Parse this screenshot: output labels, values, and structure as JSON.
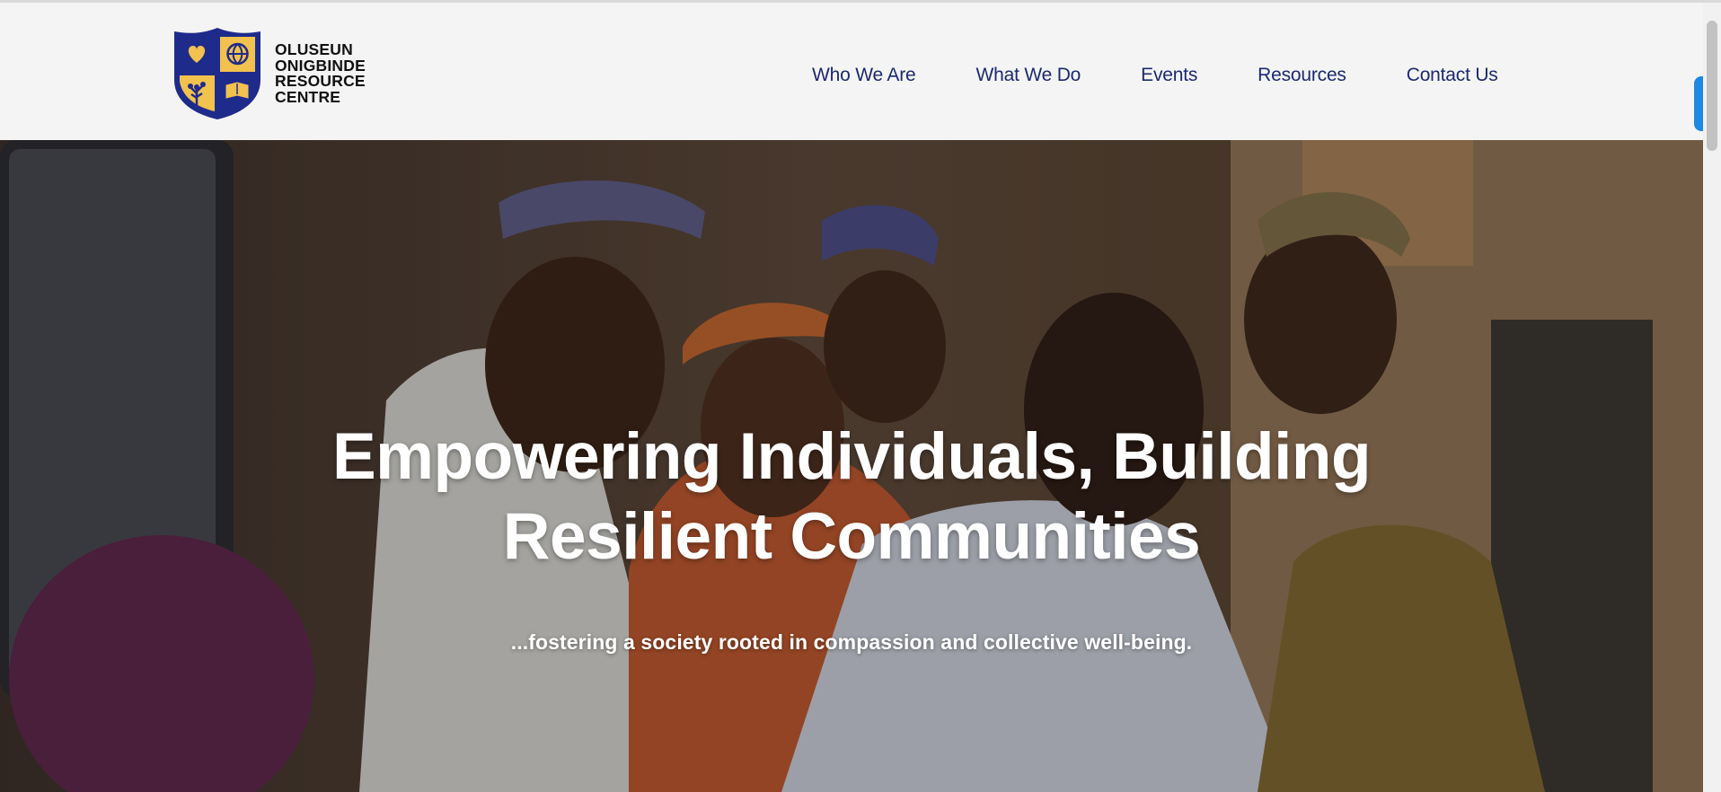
{
  "brand": {
    "name_lines": [
      "OLUSEUN",
      "ONIGBINDE",
      "RESOURCE",
      "CENTRE"
    ],
    "shield_colors": {
      "navy": "#1f2b8a",
      "gold": "#f2c14e"
    },
    "icons": [
      "heart-icon",
      "globe-icon",
      "tree-icon",
      "book-icon"
    ]
  },
  "nav": {
    "items": [
      {
        "label": "Who We Are"
      },
      {
        "label": "What We Do"
      },
      {
        "label": "Events"
      },
      {
        "label": "Resources"
      },
      {
        "label": "Contact Us"
      }
    ],
    "color": "#1c2a6e"
  },
  "hero": {
    "title_line1": "Empowering Individuals, Building",
    "title_line2": "Resilient Communities",
    "subtitle": "...fostering a society rooted in compassion and collective well-being."
  },
  "accent": "#1e88e5"
}
